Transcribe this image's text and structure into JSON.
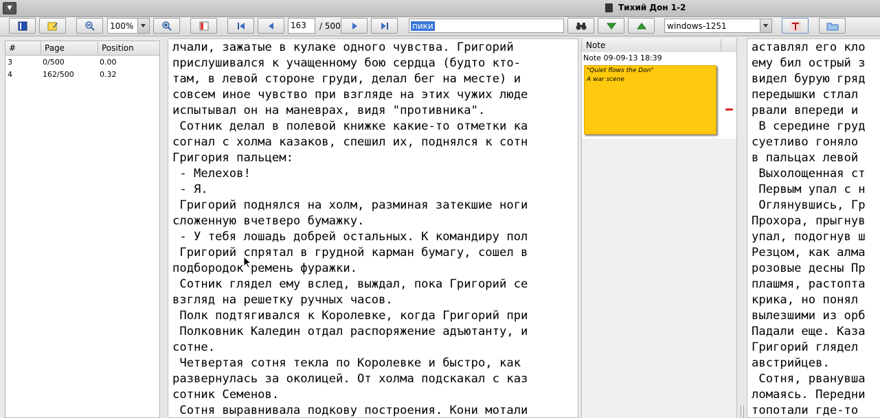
{
  "window": {
    "title": "Тихий Дон 1-2",
    "menu_icon": "menu-icon"
  },
  "toolbar": {
    "zoom": "100%",
    "current_page": "163",
    "total_pages": "/ 500",
    "search_text": "пики",
    "encoding": "windows-1251"
  },
  "bookmarks": {
    "columns": [
      "#",
      "Page",
      "Position"
    ],
    "rows": [
      {
        "num": "3",
        "page": "0/500",
        "pos": "0.00"
      },
      {
        "num": "4",
        "page": "162/500",
        "pos": "0.32"
      }
    ]
  },
  "reader": {
    "lines": [
      "лчали, зажатые в кулаке одного чувства. Григорий",
      "прислушивался к учащенному бою сердца (будто кто-",
      "там, в левой стороне груди, делал бег на месте) и",
      "совсем иное чувство при взгляде на этих чужих люде",
      "испытывал он на маневрах, видя \"противника\".",
      " Сотник делал в полевой книжке какие-то отметки ка",
      "согнал с холма казаков, спешил их, поднялся к сотн",
      "Григория пальцем:",
      " - Мелехов!",
      " - Я.",
      " Григорий поднялся на холм, разминая затекшие ноги",
      "сложенную вчетверо бумажку.",
      " - У тебя лошадь добрей остальных. К командиру пол",
      " Григорий спрятал в грудной карман бумагу, сошел в",
      "подбородок ремень фуражки.",
      " Сотник глядел ему вслед, выждал, пока Григорий се",
      "взгляд на решетку ручных часов.",
      " Полк подтягивался к Королевке, когда Григорий при",
      " Полковник Каледин отдал распоряжение адъютанту, и",
      "сотне.",
      " Четвертая сотня текла по Королевке и быстро, как",
      "развернулась за околицей. От холма подскакал с каз",
      "сотник Семенов.",
      " Сотня выравнивала подкову построения. Кони мотали"
    ],
    "right_lines": [
      "аставлял его кло",
      "ему бил острый з",
      "видел бурую гряд",
      "передышки стлал",
      "рвали впереди и",
      " В середине груд",
      "суетливо гоняло",
      "в пальцах левой",
      " Выхолощенная ст",
      " Первым упал с н",
      " Оглянувшись, Гр",
      "Прохора, прыгнув",
      "упал, подогнув ш",
      "Резцом, как алма",
      "розовые десны Пр",
      "плашмя, растопта",
      "крика, но понял",
      "вылезшими из орб",
      "Падали еще. Каза",
      "Григорий глядел",
      "австрийцев.",
      " Сотня, рванувша",
      "ломаясь. Передни",
      "топотали где-то"
    ]
  },
  "notes": {
    "header": "Note",
    "items": [
      {
        "date": "Note 09-09-13 18:39",
        "text_lines": [
          "\"Quiet flows the Don\"",
          "A war scene"
        ]
      }
    ]
  },
  "colors": {
    "note": "#ffc90e",
    "selection": "#3875d7",
    "remove": "#e02020"
  }
}
